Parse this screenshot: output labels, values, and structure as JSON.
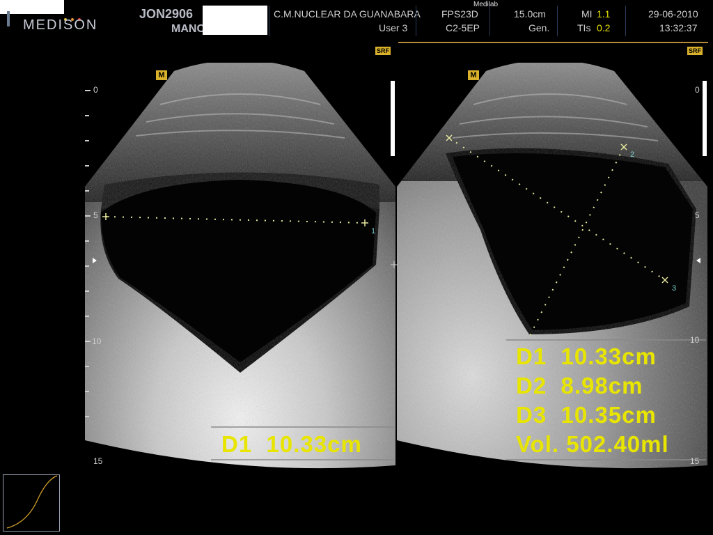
{
  "header": {
    "logo": "MEDISON",
    "patient_id": "JON2906",
    "patient_name_partial": "MANC",
    "institution": "C.M.NUCLEAR DA GUANABARA",
    "user": "User 3",
    "watermark": "Medilab",
    "preset": "FPS23D",
    "probe": "C2-5EP",
    "depth": "15.0cm",
    "mode": "Gen.",
    "mi_label": "MI",
    "mi_value": "1.1",
    "tis_label": "TIs",
    "tis_value": "0.2",
    "date": "29-06-2010",
    "time": "13:32:37",
    "dot_colors": [
      "#e0c040",
      "#e09030",
      "#e04030"
    ]
  },
  "left_panel": {
    "srf_badge": "SRF",
    "m_badge": "M",
    "depth_labels": {
      "d0": "0",
      "d5": "5",
      "d10": "10",
      "d15": "15"
    },
    "caliper_label": "1",
    "measurement": "D1  10.33cm"
  },
  "right_panel": {
    "srf_badge": "SRF",
    "m_badge": "M",
    "depth_labels": {
      "d0": "0",
      "d5": "5",
      "d10": "10",
      "d15": "15"
    },
    "caliper_labels": [
      "2",
      "3"
    ],
    "measurements": {
      "d1": "D1  10.33cm",
      "d2": "D2  8.98cm",
      "d3": "D3  10.35cm",
      "vol": "Vol. 502.40ml"
    }
  },
  "colors": {
    "measurement": "#e8e500",
    "caliper": "#e8e8a0",
    "accent": "#b88a3c"
  }
}
